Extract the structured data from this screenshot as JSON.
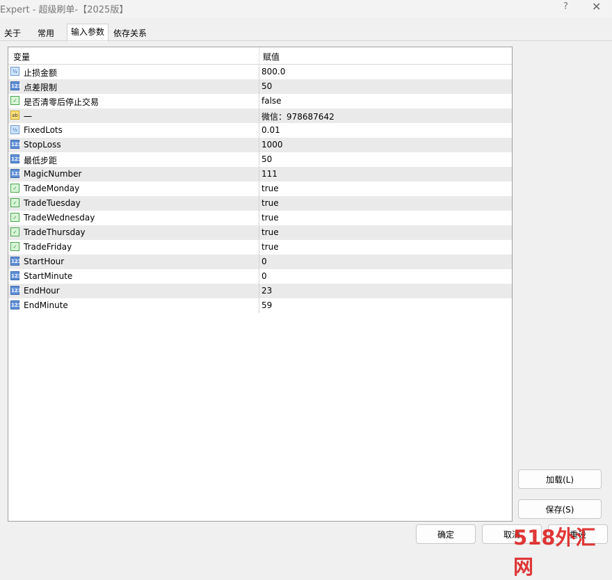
{
  "window": {
    "title": "Expert - 超级刷单-【2025版】",
    "help": "?",
    "close": "✕"
  },
  "tabs": [
    {
      "label": "关于"
    },
    {
      "label": "常用"
    },
    {
      "label": "输入参数"
    },
    {
      "label": "依存关系"
    }
  ],
  "table": {
    "columns": [
      "变量",
      "赋值"
    ],
    "rows": [
      {
        "name": "止损金额",
        "value": "800.0",
        "type": "double"
      },
      {
        "name": "点差限制",
        "value": "50",
        "type": "int"
      },
      {
        "name": "是否清零后停止交易",
        "value": "false",
        "type": "bool"
      },
      {
        "name": "一",
        "value": "微信：978687642",
        "type": "string"
      },
      {
        "name": "FixedLots",
        "value": "0.01",
        "type": "double"
      },
      {
        "name": "StopLoss",
        "value": "1000",
        "type": "int"
      },
      {
        "name": "最低步距",
        "value": "50",
        "type": "int"
      },
      {
        "name": "MagicNumber",
        "value": "111",
        "type": "int"
      },
      {
        "name": "TradeMonday",
        "value": "true",
        "type": "bool"
      },
      {
        "name": "TradeTuesday",
        "value": "true",
        "type": "bool"
      },
      {
        "name": "TradeWednesday",
        "value": "true",
        "type": "bool"
      },
      {
        "name": "TradeThursday",
        "value": "true",
        "type": "bool"
      },
      {
        "name": "TradeFriday",
        "value": "true",
        "type": "bool"
      },
      {
        "name": "StartHour",
        "value": "0",
        "type": "int"
      },
      {
        "name": "StartMinute",
        "value": "0",
        "type": "int"
      },
      {
        "name": "EndHour",
        "value": "23",
        "type": "int"
      },
      {
        "name": "EndMinute",
        "value": "59",
        "type": "int"
      }
    ]
  },
  "buttons": {
    "load": "加载(L)",
    "save": "保存(S)",
    "ok": "确定",
    "cancel": "取消",
    "reset": "重设"
  },
  "watermark": "518外汇网",
  "icon_labels": {
    "double": "½",
    "int": "123",
    "bool": "✓",
    "string": "ab"
  }
}
